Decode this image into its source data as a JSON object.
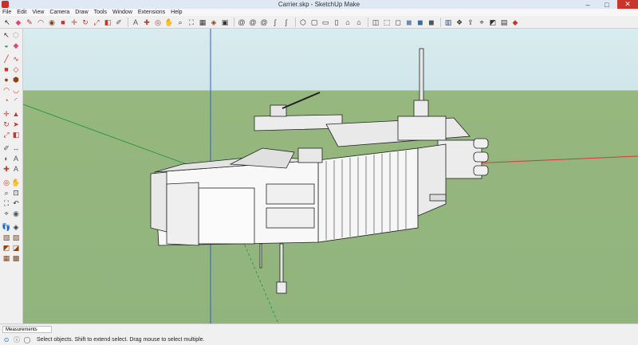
{
  "window": {
    "title": "Carrier.skp - SketchUp Make",
    "minimize": "–",
    "maximize": "□",
    "close": "✕"
  },
  "menu": [
    "File",
    "Edit",
    "View",
    "Camera",
    "Draw",
    "Tools",
    "Window",
    "Extensions",
    "Help"
  ],
  "toolbar": [
    {
      "name": "select-tool-icon",
      "glyph": "↖",
      "color": "#2a2a2a"
    },
    {
      "name": "eraser-tool-icon",
      "glyph": "◆",
      "color": "#d84a7a"
    },
    {
      "name": "line-tool-icon",
      "glyph": "✎",
      "color": "#b33030"
    },
    {
      "name": "arc-tool-icon",
      "glyph": "◠",
      "color": "#b33030"
    },
    {
      "name": "circle-tool-icon",
      "glyph": "◉",
      "color": "#7a4a20"
    },
    {
      "name": "pushpull-tool-icon",
      "glyph": "■",
      "color": "#c0392b"
    },
    {
      "name": "move-tool-icon",
      "glyph": "✛",
      "color": "#c0392b"
    },
    {
      "name": "rotate-tool-icon",
      "glyph": "↻",
      "color": "#c0392b"
    },
    {
      "name": "scale-tool-icon",
      "glyph": "⤢",
      "color": "#c0392b"
    },
    {
      "name": "offset-tool-icon",
      "glyph": "◧",
      "color": "#c0392b"
    },
    {
      "name": "tape-measure-icon",
      "glyph": "✐",
      "color": "#555"
    },
    {
      "name": "text-tool-icon",
      "glyph": "A",
      "color": "#555"
    },
    {
      "name": "axes-tool-icon",
      "glyph": "✚",
      "color": "#c0392b"
    },
    {
      "name": "orbit-tool-icon",
      "glyph": "◎",
      "color": "#c0392b"
    },
    {
      "name": "pan-tool-icon",
      "glyph": "✋",
      "color": "#a0522d"
    },
    {
      "name": "zoom-tool-icon",
      "glyph": "⌕",
      "color": "#333"
    },
    {
      "name": "zoom-extents-icon",
      "glyph": "⛶",
      "color": "#333"
    },
    {
      "name": "components-icon",
      "glyph": "▦",
      "color": "#333"
    },
    {
      "name": "materials-icon",
      "glyph": "◈",
      "color": "#8b4513"
    },
    {
      "name": "styles-icon",
      "glyph": "▣",
      "color": "#333"
    },
    {
      "name": "spiral-icon",
      "glyph": "@",
      "color": "#444"
    },
    {
      "name": "spiral-icon-2",
      "glyph": "@",
      "color": "#444"
    },
    {
      "name": "spiral-icon-3",
      "glyph": "@",
      "color": "#444"
    },
    {
      "name": "curve-icon",
      "glyph": "∫",
      "color": "#444"
    },
    {
      "name": "curve-icon-2",
      "glyph": "∫",
      "color": "#444"
    },
    {
      "name": "iso-view-icon",
      "glyph": "⬡",
      "color": "#333"
    },
    {
      "name": "top-view-icon",
      "glyph": "▢",
      "color": "#333"
    },
    {
      "name": "front-view-icon",
      "glyph": "▭",
      "color": "#333"
    },
    {
      "name": "right-view-icon",
      "glyph": "▯",
      "color": "#333"
    },
    {
      "name": "back-view-icon",
      "glyph": "⌂",
      "color": "#333"
    },
    {
      "name": "left-view-icon",
      "glyph": "⌂",
      "color": "#333"
    },
    {
      "name": "xray-style-icon",
      "glyph": "◫",
      "color": "#333"
    },
    {
      "name": "wireframe-style-icon",
      "glyph": "⬚",
      "color": "#333"
    },
    {
      "name": "hidden-line-style-icon",
      "glyph": "◻",
      "color": "#333"
    },
    {
      "name": "shaded-style-icon",
      "glyph": "◼",
      "color": "#6a8caf"
    },
    {
      "name": "textured-style-icon",
      "glyph": "◼",
      "color": "#3b6fa0"
    },
    {
      "name": "monochrome-style-icon",
      "glyph": "◼",
      "color": "#555"
    },
    {
      "name": "warehouse-icon",
      "glyph": "▥",
      "color": "#1f4e8a"
    },
    {
      "name": "extension-icon",
      "glyph": "❖",
      "color": "#333"
    },
    {
      "name": "share-icon",
      "glyph": "⇪",
      "color": "#333"
    },
    {
      "name": "geo-icon",
      "glyph": "⌖",
      "color": "#333"
    },
    {
      "name": "photo-icon",
      "glyph": "◩",
      "color": "#333"
    },
    {
      "name": "layout-icon",
      "glyph": "▤",
      "color": "#333"
    },
    {
      "name": "ruby-icon",
      "glyph": "◆",
      "color": "#c0392b"
    }
  ],
  "left_toolbar": [
    {
      "name": "select-tool-icon",
      "glyph": "↖"
    },
    {
      "name": "make-component-icon",
      "glyph": "⬡"
    },
    {
      "name": "paint-bucket-icon",
      "glyph": "◒"
    },
    {
      "name": "eraser-icon",
      "glyph": "◆"
    },
    {
      "name": "line-icon",
      "glyph": "╱"
    },
    {
      "name": "freehand-icon",
      "glyph": "∿"
    },
    {
      "name": "rectangle-icon",
      "glyph": "■"
    },
    {
      "name": "rotated-rect-icon",
      "glyph": "◇"
    },
    {
      "name": "circle-icon",
      "glyph": "●"
    },
    {
      "name": "polygon-icon",
      "glyph": "⬢"
    },
    {
      "name": "arc-icon",
      "glyph": "◠"
    },
    {
      "name": "two-point-arc-icon",
      "glyph": "◡"
    },
    {
      "name": "pie-icon",
      "glyph": "◔"
    },
    {
      "name": "three-point-arc-icon",
      "glyph": "◜"
    },
    {
      "name": "move-icon",
      "glyph": "✛"
    },
    {
      "name": "pushpull-icon",
      "glyph": "▲"
    },
    {
      "name": "rotate-icon",
      "glyph": "↻"
    },
    {
      "name": "followme-icon",
      "glyph": "➤"
    },
    {
      "name": "scale-icon",
      "glyph": "⤢"
    },
    {
      "name": "offset-icon",
      "glyph": "◧"
    },
    {
      "name": "tape-icon",
      "glyph": "✐"
    },
    {
      "name": "dimension-icon",
      "glyph": "↔"
    },
    {
      "name": "protractor-icon",
      "glyph": "◐"
    },
    {
      "name": "text-icon",
      "glyph": "A"
    },
    {
      "name": "axes-icon",
      "glyph": "✚"
    },
    {
      "name": "3d-text-icon",
      "glyph": "A"
    },
    {
      "name": "orbit-icon",
      "glyph": "◎"
    },
    {
      "name": "pan-icon",
      "glyph": "✋"
    },
    {
      "name": "zoom-icon",
      "glyph": "⌕"
    },
    {
      "name": "zoom-window-icon",
      "glyph": "⊡"
    },
    {
      "name": "zoom-extents-icon",
      "glyph": "⛶"
    },
    {
      "name": "previous-view-icon",
      "glyph": "↶"
    },
    {
      "name": "position-camera-icon",
      "glyph": "⌖"
    },
    {
      "name": "look-around-icon",
      "glyph": "◉"
    },
    {
      "name": "walk-icon",
      "glyph": "👣"
    },
    {
      "name": "section-icon",
      "glyph": "◈"
    },
    {
      "name": "sandbox-icon",
      "glyph": "▧"
    },
    {
      "name": "sandbox-2-icon",
      "glyph": "▨"
    },
    {
      "name": "sandbox-3-icon",
      "glyph": "◩"
    },
    {
      "name": "sandbox-4-icon",
      "glyph": "◪"
    },
    {
      "name": "sandbox-5-icon",
      "glyph": "▦"
    },
    {
      "name": "sandbox-6-icon",
      "glyph": "▩"
    }
  ],
  "measurements": {
    "label": "Measurements"
  },
  "status": {
    "text": "Select objects. Shift to extend select. Drag mouse to select multiple."
  },
  "colors": {
    "sky": "#cfe6ea",
    "ground": "#93b57e",
    "axis_red": "#d23a3a",
    "axis_green": "#2e9a4a",
    "axis_blue": "#3a5ad2"
  }
}
